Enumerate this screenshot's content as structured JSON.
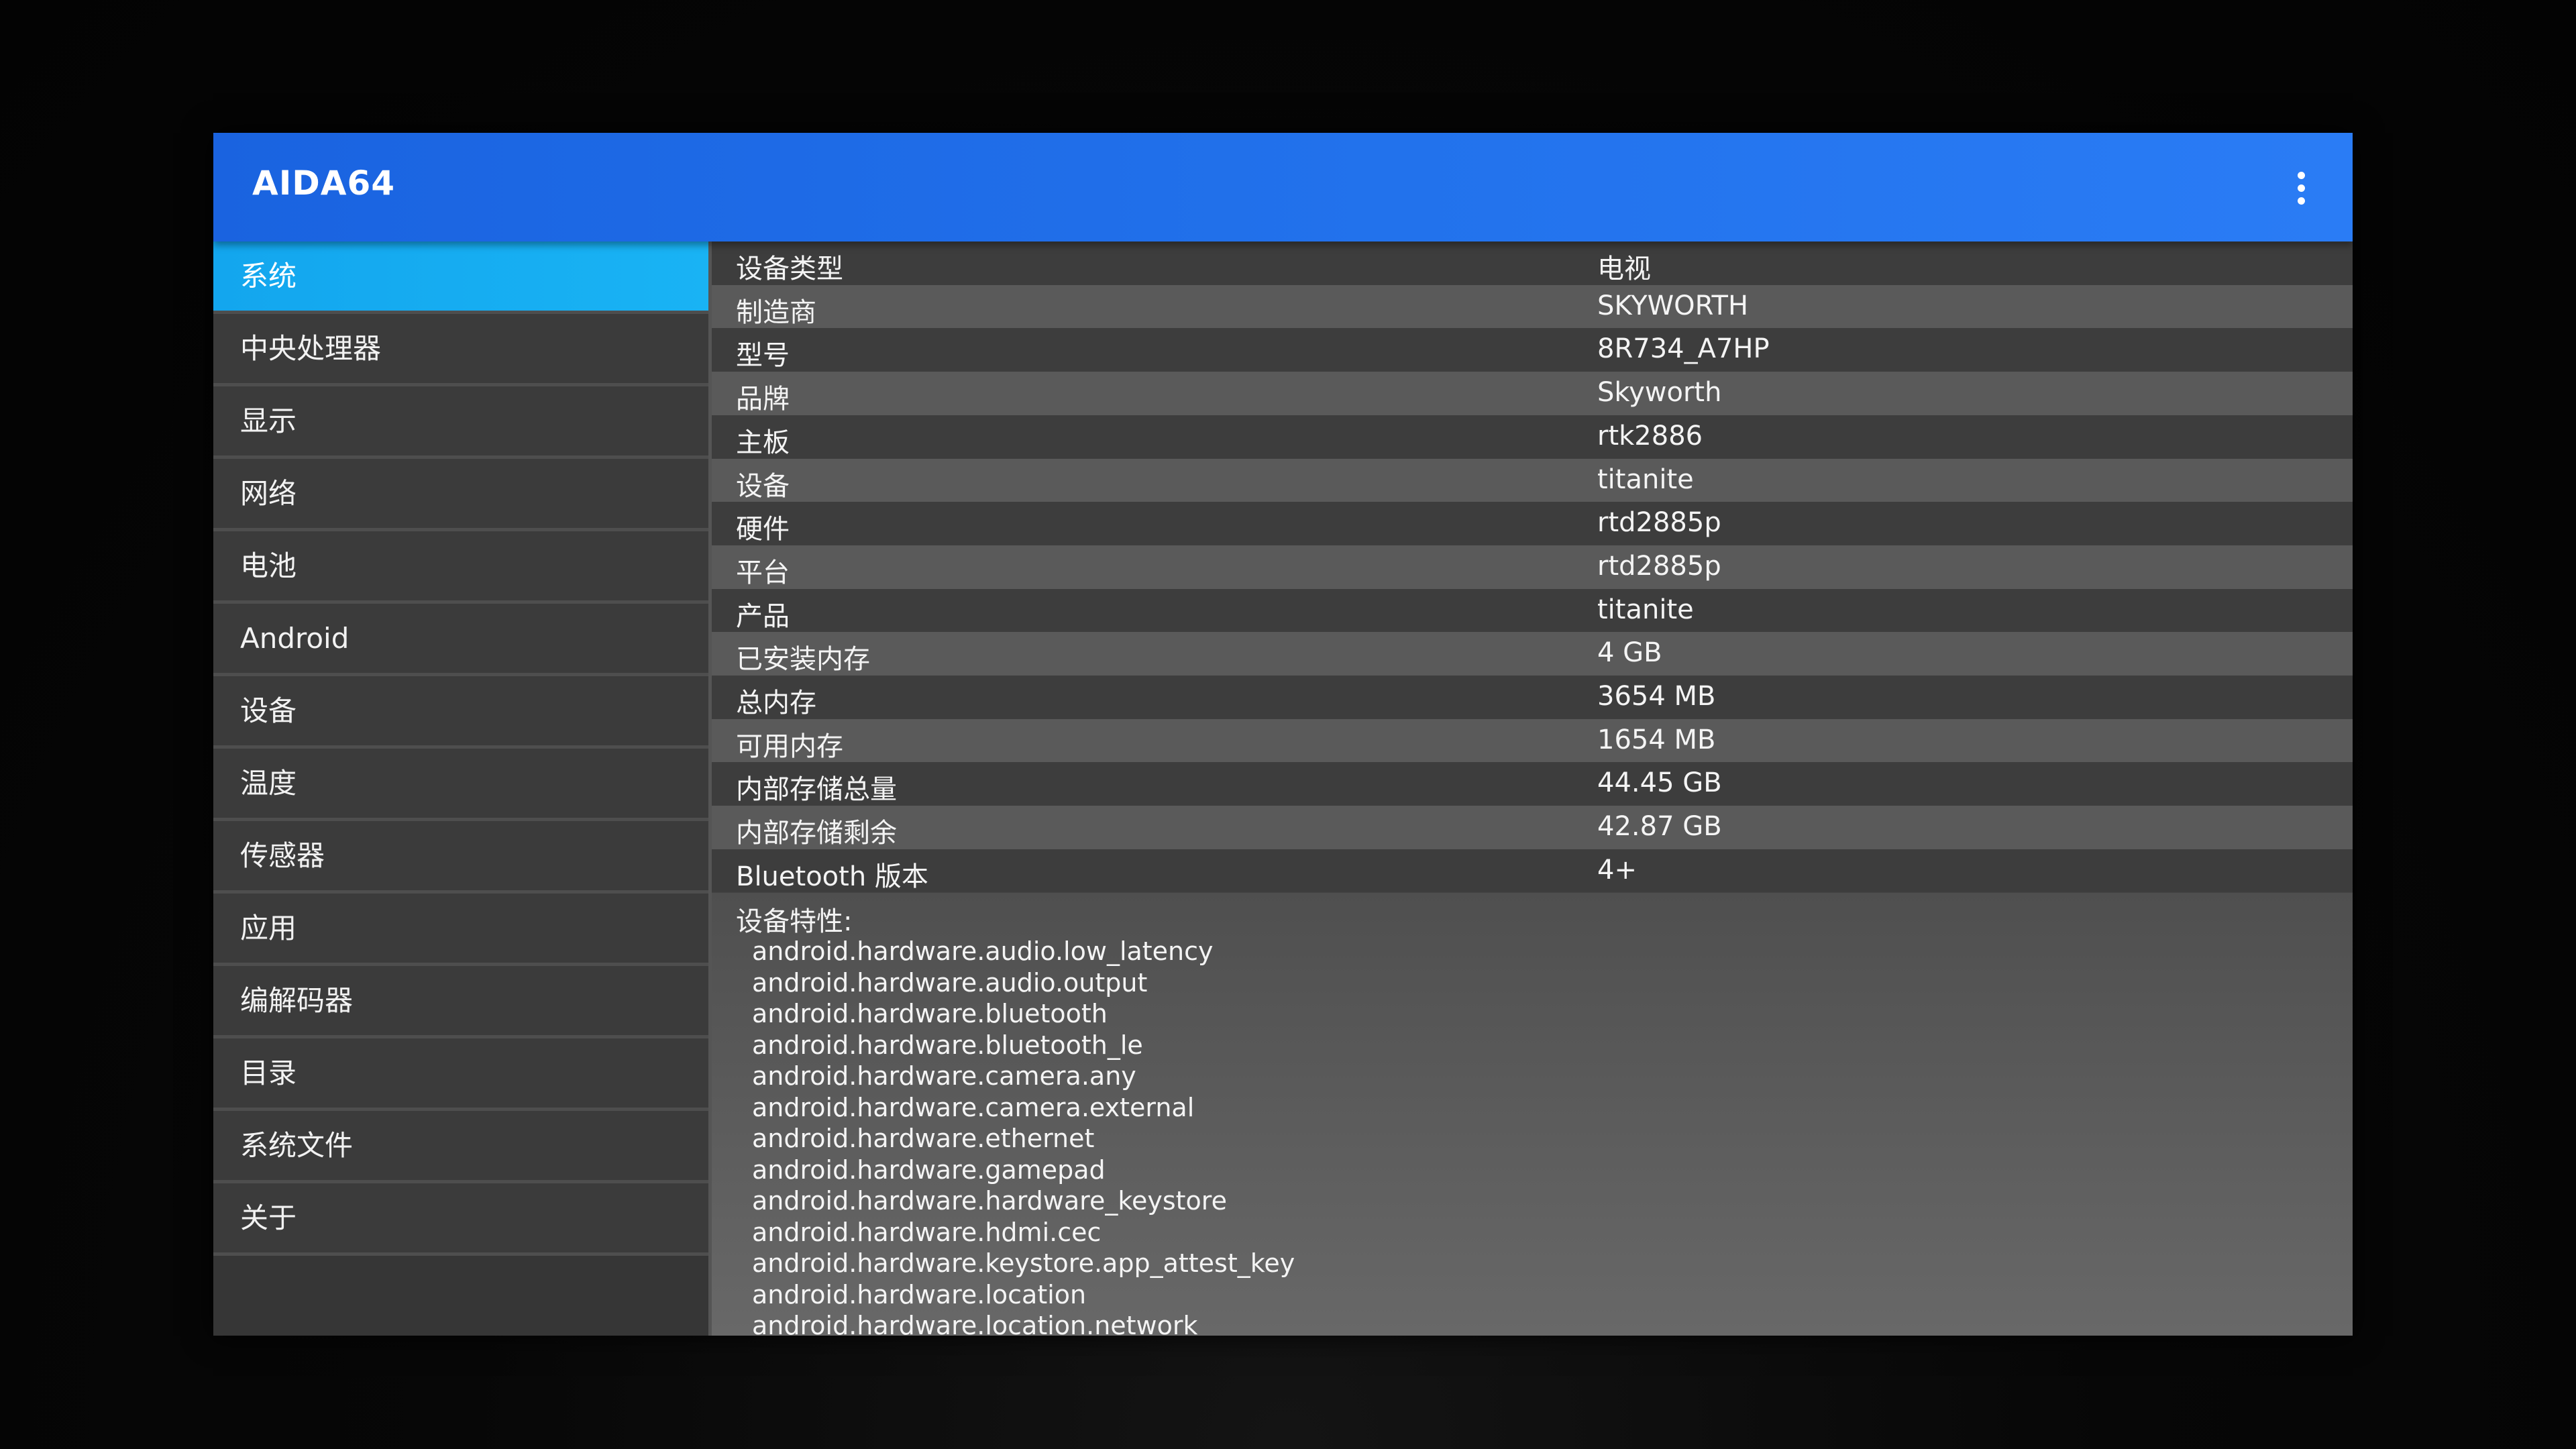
{
  "app": {
    "title": "AIDA64"
  },
  "icons": {
    "overflow_menu": "more-vert-icon"
  },
  "colors": {
    "appbar": "#1f6fe8",
    "selected_item": "#17aef2",
    "sidebar": "#3b3b3b",
    "row_light": "#5a5a5a",
    "row_dark": "#3d3d3d"
  },
  "sidebar": {
    "selected_index": 0,
    "items": [
      {
        "label": "系统"
      },
      {
        "label": "中央处理器"
      },
      {
        "label": "显示"
      },
      {
        "label": "网络"
      },
      {
        "label": "电池"
      },
      {
        "label": "Android"
      },
      {
        "label": "设备"
      },
      {
        "label": "温度"
      },
      {
        "label": "传感器"
      },
      {
        "label": "应用"
      },
      {
        "label": "编解码器"
      },
      {
        "label": "目录"
      },
      {
        "label": "系统文件"
      },
      {
        "label": "关于"
      }
    ]
  },
  "details": {
    "rows": [
      {
        "key": "设备类型",
        "value": "电视"
      },
      {
        "key": "制造商",
        "value": "SKYWORTH"
      },
      {
        "key": "型号",
        "value": "8R734_A7HP"
      },
      {
        "key": "品牌",
        "value": "Skyworth"
      },
      {
        "key": "主板",
        "value": "rtk2886"
      },
      {
        "key": "设备",
        "value": "titanite"
      },
      {
        "key": "硬件",
        "value": "rtd2885p"
      },
      {
        "key": "平台",
        "value": "rtd2885p"
      },
      {
        "key": "产品",
        "value": "titanite"
      },
      {
        "key": "已安装内存",
        "value": "4 GB"
      },
      {
        "key": "总内存",
        "value": "3654 MB"
      },
      {
        "key": "可用内存",
        "value": "1654 MB"
      },
      {
        "key": "内部存储总量",
        "value": "44.45 GB"
      },
      {
        "key": "内部存储剩余",
        "value": "42.87 GB"
      },
      {
        "key": "Bluetooth 版本",
        "value": "4+"
      }
    ],
    "features_title": "设备特性:",
    "features": [
      "android.hardware.audio.low_latency",
      "android.hardware.audio.output",
      "android.hardware.bluetooth",
      "android.hardware.bluetooth_le",
      "android.hardware.camera.any",
      "android.hardware.camera.external",
      "android.hardware.ethernet",
      "android.hardware.gamepad",
      "android.hardware.hardware_keystore",
      "android.hardware.hdmi.cec",
      "android.hardware.keystore.app_attest_key",
      "android.hardware.location",
      "android.hardware.location.network"
    ]
  }
}
